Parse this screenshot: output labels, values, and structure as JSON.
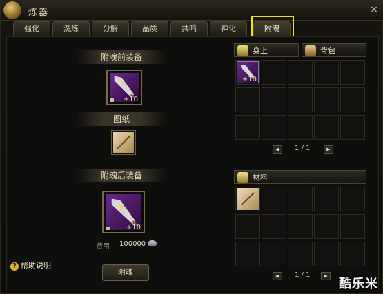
{
  "window": {
    "title": "炼器",
    "close": "×"
  },
  "tabs": [
    {
      "label": "强化"
    },
    {
      "label": "洗炼"
    },
    {
      "label": "分解"
    },
    {
      "label": "品质"
    },
    {
      "label": "共鸣"
    },
    {
      "label": "神化"
    },
    {
      "label": "附魂",
      "active": true
    }
  ],
  "left": {
    "before_label": "附魂前装备",
    "before_item_level": "+10",
    "blueprint_label": "图纸",
    "after_label": "附魂后装备",
    "after_item_level": "+10",
    "fee_label": "费用",
    "fee_value": "100000",
    "fee_icon": "silver-ingot-icon",
    "action_button": "附魂",
    "help": "帮助说明"
  },
  "right": {
    "tab_equipped": "身上",
    "tab_bag": "背包",
    "equipped_item_level": "+10",
    "equipped_page": "1 / 1",
    "materials_label": "材料",
    "materials_page": "1 / 1"
  },
  "watermark": "酷乐米",
  "colors": {
    "highlight": "#f0e410",
    "purple_item": "#6b2a8c",
    "gold_border": "#7a6a44"
  }
}
